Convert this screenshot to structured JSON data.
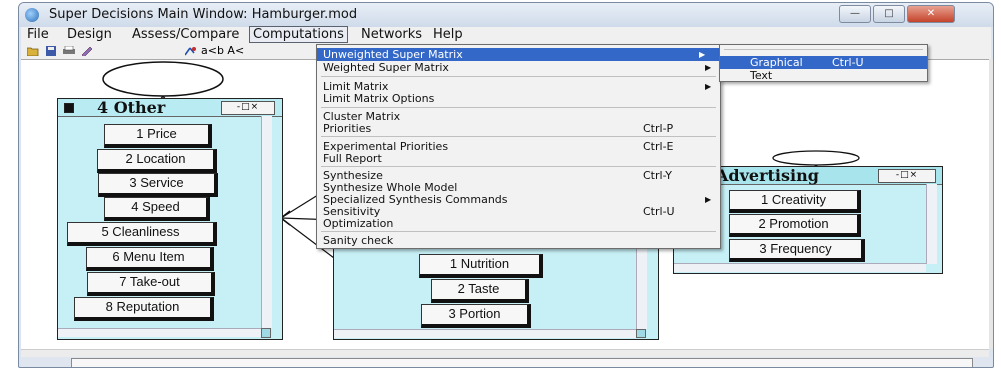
{
  "window": {
    "title": "Super Decisions Main Window: Hamburger.mod"
  },
  "menubar": [
    "File",
    "Design",
    "Assess/Compare",
    "Computations",
    "Networks",
    "Help"
  ],
  "toolbar": {
    "text": "a<b A<"
  },
  "computations_menu": {
    "items": [
      {
        "label": "Unweighted Super Matrix",
        "shortcut": "",
        "has_submenu": true,
        "highlighted": true
      },
      {
        "label": "Weighted Super Matrix",
        "shortcut": "",
        "has_submenu": true
      },
      {
        "label": "Limit Matrix",
        "shortcut": "",
        "has_submenu": true
      },
      {
        "label": "Limit Matrix Options",
        "shortcut": ""
      },
      {
        "label": "Cluster Matrix",
        "shortcut": ""
      },
      {
        "label": "Priorities",
        "shortcut": "Ctrl-P"
      },
      {
        "label": "Experimental Priorities",
        "shortcut": "Ctrl-E"
      },
      {
        "label": "Full Report",
        "shortcut": ""
      },
      {
        "label": "Synthesize",
        "shortcut": "Ctrl-Y"
      },
      {
        "label": "Synthesize Whole Model",
        "shortcut": ""
      },
      {
        "label": "Specialized Synthesis Commands",
        "shortcut": "",
        "has_submenu": true
      },
      {
        "label": "Sensitivity",
        "shortcut": "Ctrl-U"
      },
      {
        "label": "Optimization",
        "shortcut": ""
      },
      {
        "label": "Sanity check",
        "shortcut": ""
      }
    ]
  },
  "submenu": {
    "items": [
      {
        "label": "Graphical",
        "shortcut": "Ctrl-U",
        "highlighted": true
      },
      {
        "label": "Text",
        "shortcut": ""
      }
    ]
  },
  "clusters": {
    "other": {
      "name": "4 Other",
      "nodes": [
        "1 Price",
        "2 Location",
        "3 Service",
        "4 Speed",
        "5 Cleanliness",
        "6 Menu Item",
        "7 Take-out",
        "8 Reputation"
      ]
    },
    "hidden": {
      "nodes": [
        "1 Nutrition",
        "2 Taste",
        "3 Portion"
      ]
    },
    "advertising": {
      "name": "Advertising",
      "nodes": [
        "1 Creativity",
        "2 Promotion",
        "3 Frequency"
      ]
    }
  },
  "colors": {
    "cluster_bg": "#c6f0f6",
    "highlight": "#3468c8"
  },
  "icons": [
    "app-icon",
    "open-folder-icon",
    "save-disk-icon",
    "print-icon",
    "edit-icon",
    "compare-icon"
  ]
}
